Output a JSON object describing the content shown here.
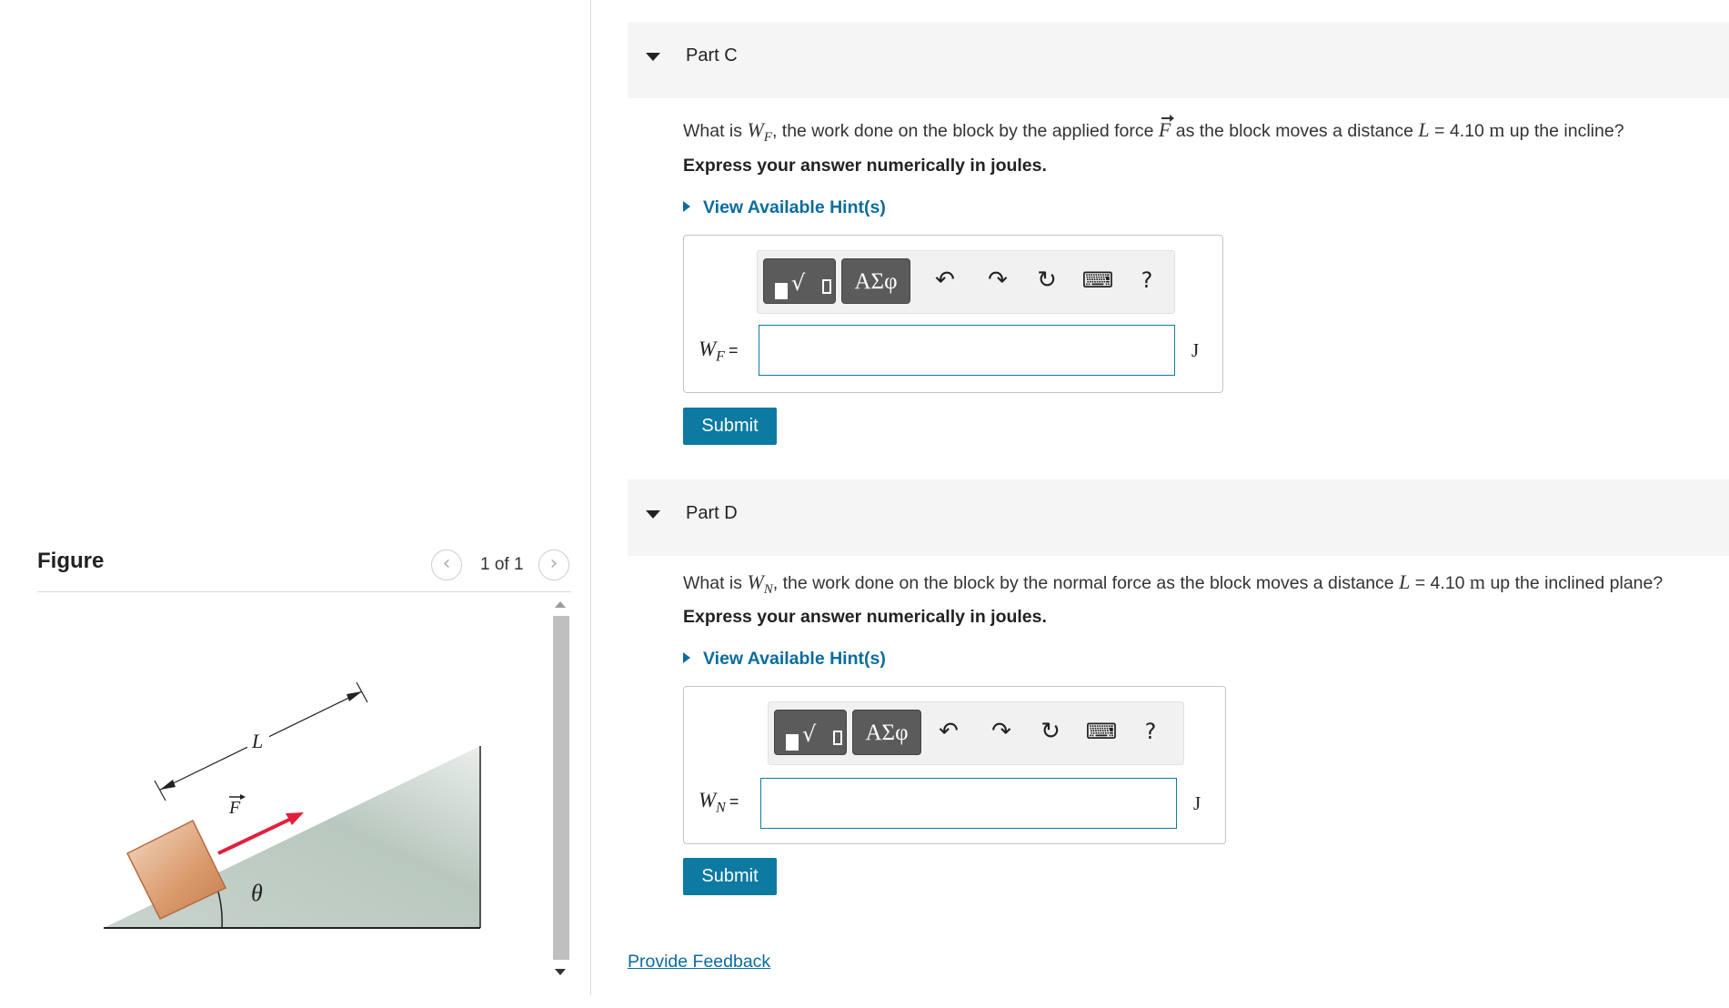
{
  "figure": {
    "title": "Figure",
    "pager_text": "1 of 1",
    "prev_glyph": "‹",
    "next_glyph": "›",
    "labels": {
      "length": "L",
      "force": "F",
      "angle": "θ"
    }
  },
  "parts": [
    {
      "label": "Part C",
      "question_pre": "What is ",
      "symbol": "W",
      "subscript": "F",
      "question_mid": ", the work done on the block by the applied force ",
      "force_symbol": "F",
      "question_mid2": " as the block moves a distance ",
      "dist_symbol": "L",
      "dist_value": " = 4.10 ",
      "dist_unit": "m",
      "question_post": " up the incline?",
      "express": "Express your answer numerically in joules.",
      "hint": "View Available Hint(s)",
      "field_label": "W",
      "field_sub": "F",
      "field_eq": "=",
      "input_value": "",
      "unit": "J",
      "submit": "Submit"
    },
    {
      "label": "Part D",
      "question_pre": "What is ",
      "symbol": "W",
      "subscript": "N",
      "question_mid": ", the work done on the block by the normal force as the block moves a distance ",
      "dist_symbol": "L",
      "dist_value": " = 4.10 ",
      "dist_unit": "m",
      "question_post": " up the inclined plane?",
      "express": "Express your answer numerically in joules.",
      "hint": "View Available Hint(s)",
      "field_label": "W",
      "field_sub": "N",
      "field_eq": "=",
      "input_value": "",
      "unit": "J",
      "submit": "Submit"
    }
  ],
  "toolbar": {
    "greek": "ΑΣφ",
    "help": "?",
    "icons": [
      "templates-icon",
      "greek-symbols-icon",
      "undo-icon",
      "redo-icon",
      "reset-icon",
      "keyboard-icon",
      "help-icon"
    ]
  },
  "feedback": "Provide Feedback"
}
